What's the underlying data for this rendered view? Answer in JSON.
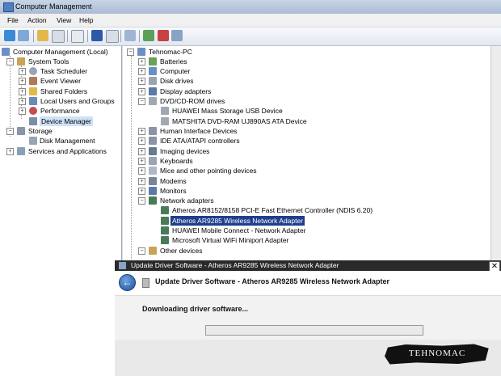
{
  "window": {
    "title": "Computer Management"
  },
  "menu": [
    "File",
    "Action",
    "View",
    "Help"
  ],
  "left_tree": [
    {
      "label": "Computer Management (Local)"
    },
    {
      "label": "System Tools"
    },
    {
      "label": "Task Scheduler"
    },
    {
      "label": "Event Viewer"
    },
    {
      "label": "Shared Folders"
    },
    {
      "label": "Local Users and Groups"
    },
    {
      "label": "Performance"
    },
    {
      "label": "Device Manager"
    },
    {
      "label": "Storage"
    },
    {
      "label": "Disk Management"
    },
    {
      "label": "Services and Applications"
    }
  ],
  "device_tree": [
    {
      "label": "Tehnomac-PC"
    },
    {
      "label": "Batteries"
    },
    {
      "label": "Computer"
    },
    {
      "label": "Disk drives"
    },
    {
      "label": "Display adapters"
    },
    {
      "label": "DVD/CD-ROM drives"
    },
    {
      "label": "HUAWEI Mass Storage USB Device"
    },
    {
      "label": "MATSHITA DVD-RAM UJ890AS ATA Device"
    },
    {
      "label": "Human Interface Devices"
    },
    {
      "label": "IDE ATA/ATAPI controllers"
    },
    {
      "label": "Imaging devices"
    },
    {
      "label": "Keyboards"
    },
    {
      "label": "Mice and other pointing devices"
    },
    {
      "label": "Modems"
    },
    {
      "label": "Monitors"
    },
    {
      "label": "Network adapters"
    },
    {
      "label": "Atheros AR8152/8158 PCI-E Fast Ethernet Controller (NDIS 6.20)"
    },
    {
      "label": "Atheros AR9285 Wireless Network Adapter"
    },
    {
      "label": "HUAWEI Mobile Connect - Network Adapter"
    },
    {
      "label": "Microsoft Virtual WiFi Miniport Adapter"
    },
    {
      "label": "Other devices"
    }
  ],
  "dialog": {
    "title": "Update Driver Software - Atheros AR9285 Wireless Network Adapter",
    "heading": "Update Driver Software - Atheros AR9285 Wireless Network Adapter",
    "status": "Downloading driver software...",
    "close_glyph": "✕",
    "back_glyph": "←",
    "progress": 0
  },
  "watermark": "TEHNOMAC",
  "colors": {
    "selection": "#1f3f8c",
    "titlebar": "#a9bbd6",
    "dialog_title": "#2a2a2a"
  }
}
